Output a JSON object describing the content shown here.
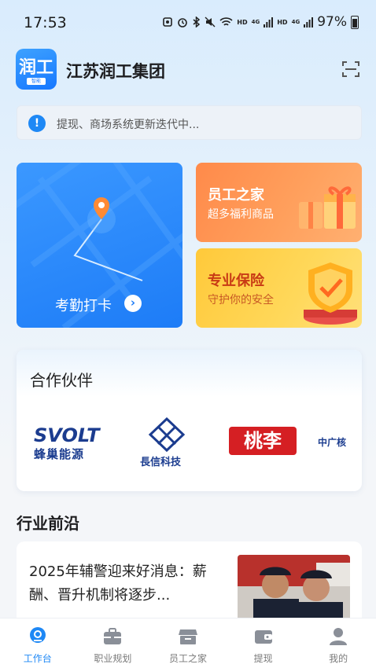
{
  "status_bar": {
    "time": "17:53",
    "indicators": [
      "HD",
      "4G",
      "HD",
      "4G"
    ],
    "battery": "97%"
  },
  "header": {
    "logo_text": "润工",
    "logo_sub": "智能",
    "company_name": "江苏润工集团"
  },
  "notice": {
    "text": "提现、商场系统更新迭代中..."
  },
  "cards": {
    "attendance": {
      "label": "考勤打卡"
    },
    "employee_home": {
      "title": "员工之家",
      "subtitle": "超多福利商品"
    },
    "insurance": {
      "title": "专业保险",
      "subtitle": "守护你的安全"
    }
  },
  "partners": {
    "title": "合作伙伴",
    "logos": [
      {
        "en": "SVOLT",
        "cn": "蜂巢能源"
      },
      {
        "cn": "長信科技"
      },
      {
        "cn": "桃李"
      },
      {
        "cn": "中广核"
      }
    ]
  },
  "industry": {
    "title": "行业前沿",
    "news": [
      {
        "title": "2025年辅警迎来好消息：薪酬、晋升机制将逐步..."
      }
    ]
  },
  "tabbar": {
    "items": [
      {
        "label": "工作台",
        "icon": "workbench-icon",
        "active": true
      },
      {
        "label": "职业规划",
        "icon": "briefcase-icon",
        "active": false
      },
      {
        "label": "员工之家",
        "icon": "store-icon",
        "active": false
      },
      {
        "label": "提现",
        "icon": "wallet-icon",
        "active": false
      },
      {
        "label": "我的",
        "icon": "user-icon",
        "active": false
      }
    ]
  },
  "colors": {
    "primary": "#1e88f5",
    "attendance_bg": "#2a8af9",
    "home_bg": "#ff9152",
    "insurance_bg": "#ffd048",
    "tab_inactive": "#7a7a7a"
  }
}
